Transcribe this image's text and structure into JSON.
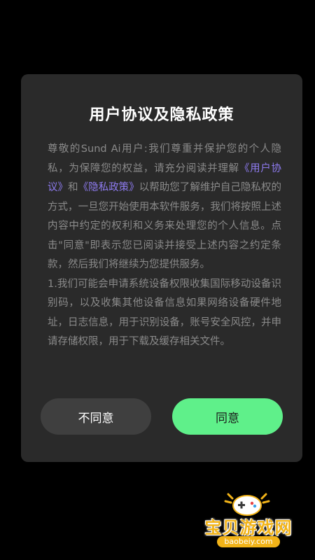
{
  "dialog": {
    "title": "用户协议及隐私政策",
    "body": {
      "intro_before": "尊敬的Sund Ai用户:我们尊重并保护您的个人隐私，为保障您的权益，请充分阅读并理解",
      "user_agreement_link": "《用户协议》",
      "and": "和",
      "privacy_policy_link": "《隐私政策》",
      "intro_after": "以帮助您了解维护自己隐私权的方式，一旦您开始使用本软件服务，我们将按照上述内容中约定的权利和义务来处理您的个人信息。点击\"同意\"即表示您已阅读并接受上述内容之约定条款，然后我们将继续为您提供服务。",
      "item1": "1.我们可能会申请系统设备权限收集国际移动设备识别码，以及收集其他设备信息如果网络设备硬件地址，日志信息，用于识别设备，账号安全风控，并申请存储权限，用于下载及缓存相关文件。"
    },
    "disagree_label": "不同意",
    "agree_label": "同意"
  },
  "watermark": {
    "title": "宝贝游戏网",
    "url": "baobeiy.com"
  },
  "colors": {
    "background": "#000000",
    "dialog": "#2a2a2a",
    "link": "#8e7bf0",
    "agree": "#5ff08a",
    "disagree": "#3f3f3f"
  }
}
